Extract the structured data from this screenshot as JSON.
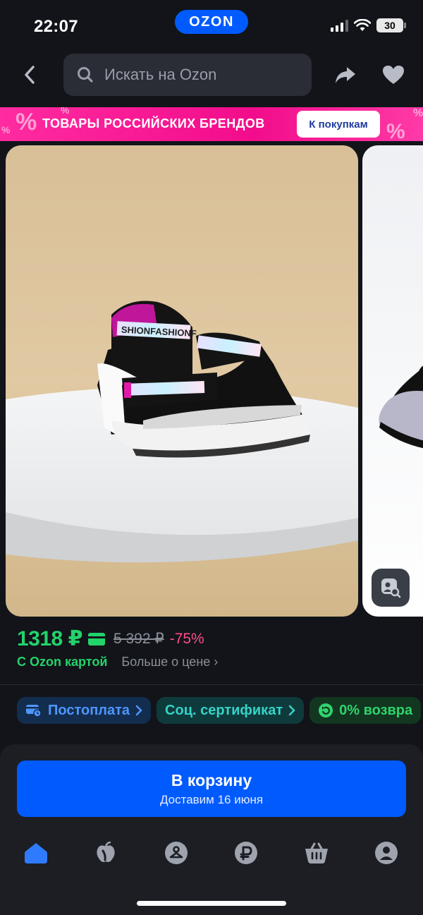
{
  "status_bar": {
    "time": "22:07",
    "logo": "OZON",
    "battery": "30"
  },
  "search": {
    "placeholder": "Искать на Ozon"
  },
  "promo": {
    "text": "ТОВАРЫ РОССИЙСКИХ БРЕНДОВ",
    "button": "К покупкам",
    "percent": "%"
  },
  "product": {
    "image_text": "SHIONFASHIONF",
    "price": "1318 ₽",
    "old_price": "5 392 ₽",
    "discount": "-75%",
    "ozon_card_label": "С Ozon картой",
    "more_price_link": "Больше о цене ›"
  },
  "chips": [
    {
      "label": "Постоплата",
      "icon": "card-clock-icon"
    },
    {
      "label": "Соц. сертификат",
      "icon": ""
    },
    {
      "label": "0% возвра",
      "icon": "return-icon"
    }
  ],
  "cart": {
    "title": "В корзину",
    "subtitle": "Доставим 16 июня"
  },
  "tabbar": [
    "home-icon",
    "fresh-icon",
    "catalog-icon",
    "finance-icon",
    "cart-icon",
    "profile-icon"
  ],
  "colors": {
    "accent": "#005bff",
    "green": "#22d36b",
    "discount": "#ff4d8d",
    "promo": "#f20c8b"
  }
}
